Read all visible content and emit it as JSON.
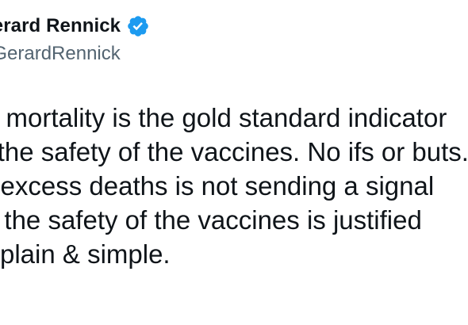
{
  "tweet": {
    "display_name": "Gerard Rennick",
    "handle": "@GerardRennick",
    "body_lines": [
      "Excess mortality is the gold standard indicator",
      "for the safety of the vaccines. No ifs or buts.",
      "If excess deaths is not sending a signal",
      "then the safety of the vaccines is justified",
      "plain & simple."
    ],
    "verified_icon": "verified-badge-icon",
    "colors": {
      "text": "#0f1419",
      "secondary": "#536471",
      "verified": "#1d9bf0"
    }
  }
}
